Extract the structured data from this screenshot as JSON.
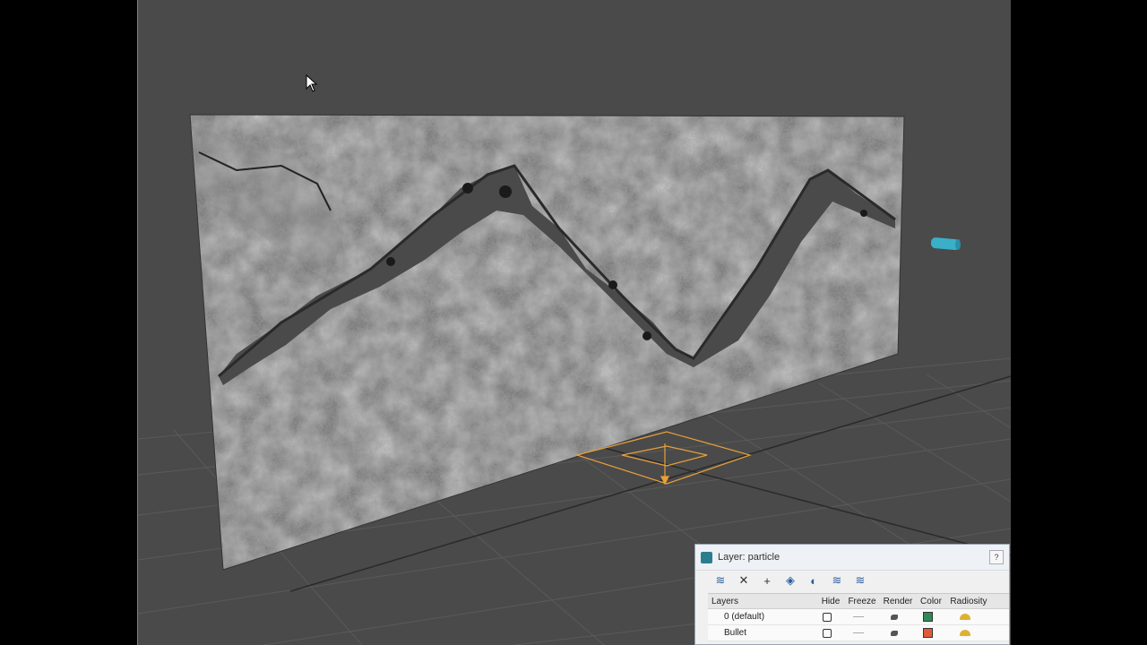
{
  "viewport": {
    "background": "#4a4a4a"
  },
  "layer_panel": {
    "title": "Layer: particle",
    "help_label": "?",
    "toolbar": [
      {
        "name": "create-layer",
        "glyph": "≋"
      },
      {
        "name": "delete-layer",
        "glyph": "✕"
      },
      {
        "name": "add-to-layer",
        "glyph": "+"
      },
      {
        "name": "select-in-layer",
        "glyph": "◈"
      },
      {
        "name": "highlight-layer",
        "glyph": "◐"
      },
      {
        "name": "hide-all",
        "glyph": "≋"
      },
      {
        "name": "freeze-all",
        "glyph": "≋"
      }
    ],
    "columns": {
      "layers": "Layers",
      "hide": "Hide",
      "freeze": "Freeze",
      "render": "Render",
      "color": "Color",
      "radiosity": "Radiosity"
    },
    "rows": [
      {
        "name": "0 (default)",
        "color": "#2e8b57"
      },
      {
        "name": "Bullet",
        "color": "#e05a3a"
      }
    ]
  }
}
